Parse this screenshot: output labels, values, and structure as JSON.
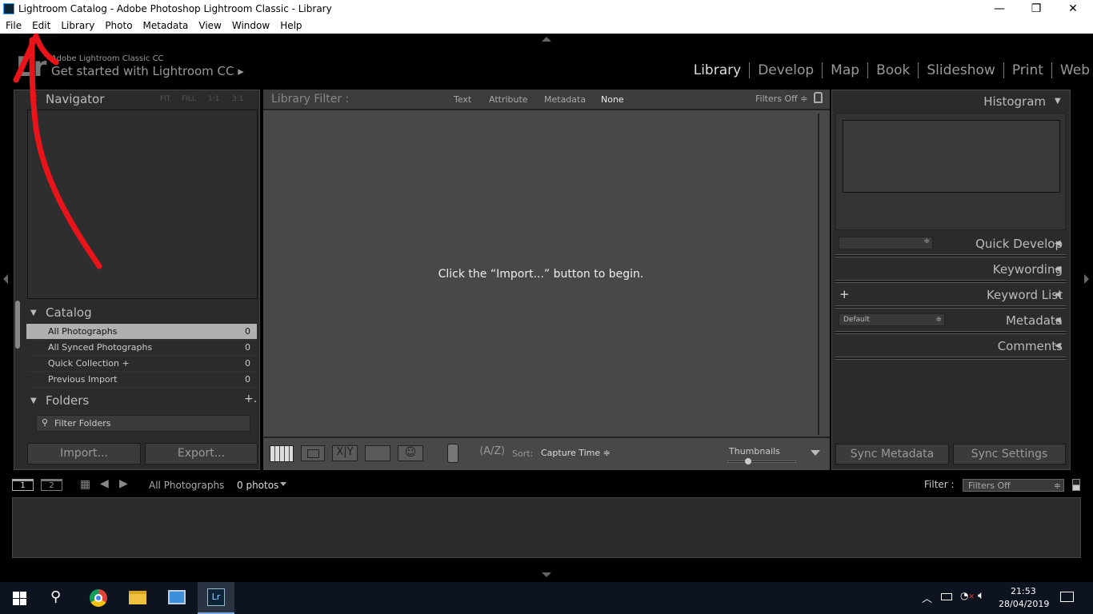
{
  "window": {
    "title": "Lightroom Catalog - Adobe Photoshop Lightroom Classic - Library",
    "minimize": "—",
    "restore": "❐",
    "close": "✕"
  },
  "menu": [
    "File",
    "Edit",
    "Library",
    "Photo",
    "Metadata",
    "View",
    "Window",
    "Help"
  ],
  "identity": {
    "logo": "Lr",
    "product": "Adobe Lightroom Classic CC",
    "tagline": "Get started with Lightroom CC ▸"
  },
  "modules": [
    "Library",
    "Develop",
    "Map",
    "Book",
    "Slideshow",
    "Print",
    "Web"
  ],
  "navigator": {
    "title": "Navigator",
    "zooms": [
      "FIT",
      "FILL",
      "1:1",
      "3:1"
    ]
  },
  "catalog": {
    "title": "Catalog",
    "items": [
      {
        "label": "All Photographs",
        "count": "0"
      },
      {
        "label": "All Synced Photographs",
        "count": "0"
      },
      {
        "label": "Quick Collection +",
        "count": "0"
      },
      {
        "label": "Previous Import",
        "count": "0"
      }
    ]
  },
  "folders": {
    "title": "Folders",
    "filter_placeholder": "Filter Folders",
    "add": "+."
  },
  "buttons": {
    "import": "Import...",
    "export": "Export...",
    "sync_metadata": "Sync Metadata",
    "sync_settings": "Sync Settings"
  },
  "filter_bar": {
    "label": "Library Filter :",
    "options": [
      "Text",
      "Attribute",
      "Metadata",
      "None"
    ],
    "active": "None",
    "status": "Filters Off ≑"
  },
  "center": {
    "message": "Click the “Import...” button to begin."
  },
  "toolbar": {
    "sort_label": "Sort:",
    "sort_value": "Capture Time ≑",
    "thumbnails": "Thumbnails",
    "thumbnail_size": 0.3
  },
  "right": {
    "histogram": "Histogram",
    "panels": [
      "Quick Develop",
      "Keywording",
      "Keyword List",
      "Metadata",
      "Comments"
    ],
    "metadata_preset": "Default"
  },
  "filmstrip": {
    "screen1": "1",
    "screen2": "2",
    "source": "All Photographs",
    "count": "0 photos",
    "filter_label": "Filter :",
    "filter_value": "Filters Off"
  },
  "taskbar": {
    "time": "21:53",
    "date": "28/04/2019"
  },
  "colors": {
    "annotation": "#e8141a",
    "active_row": "#b0b0b0"
  }
}
